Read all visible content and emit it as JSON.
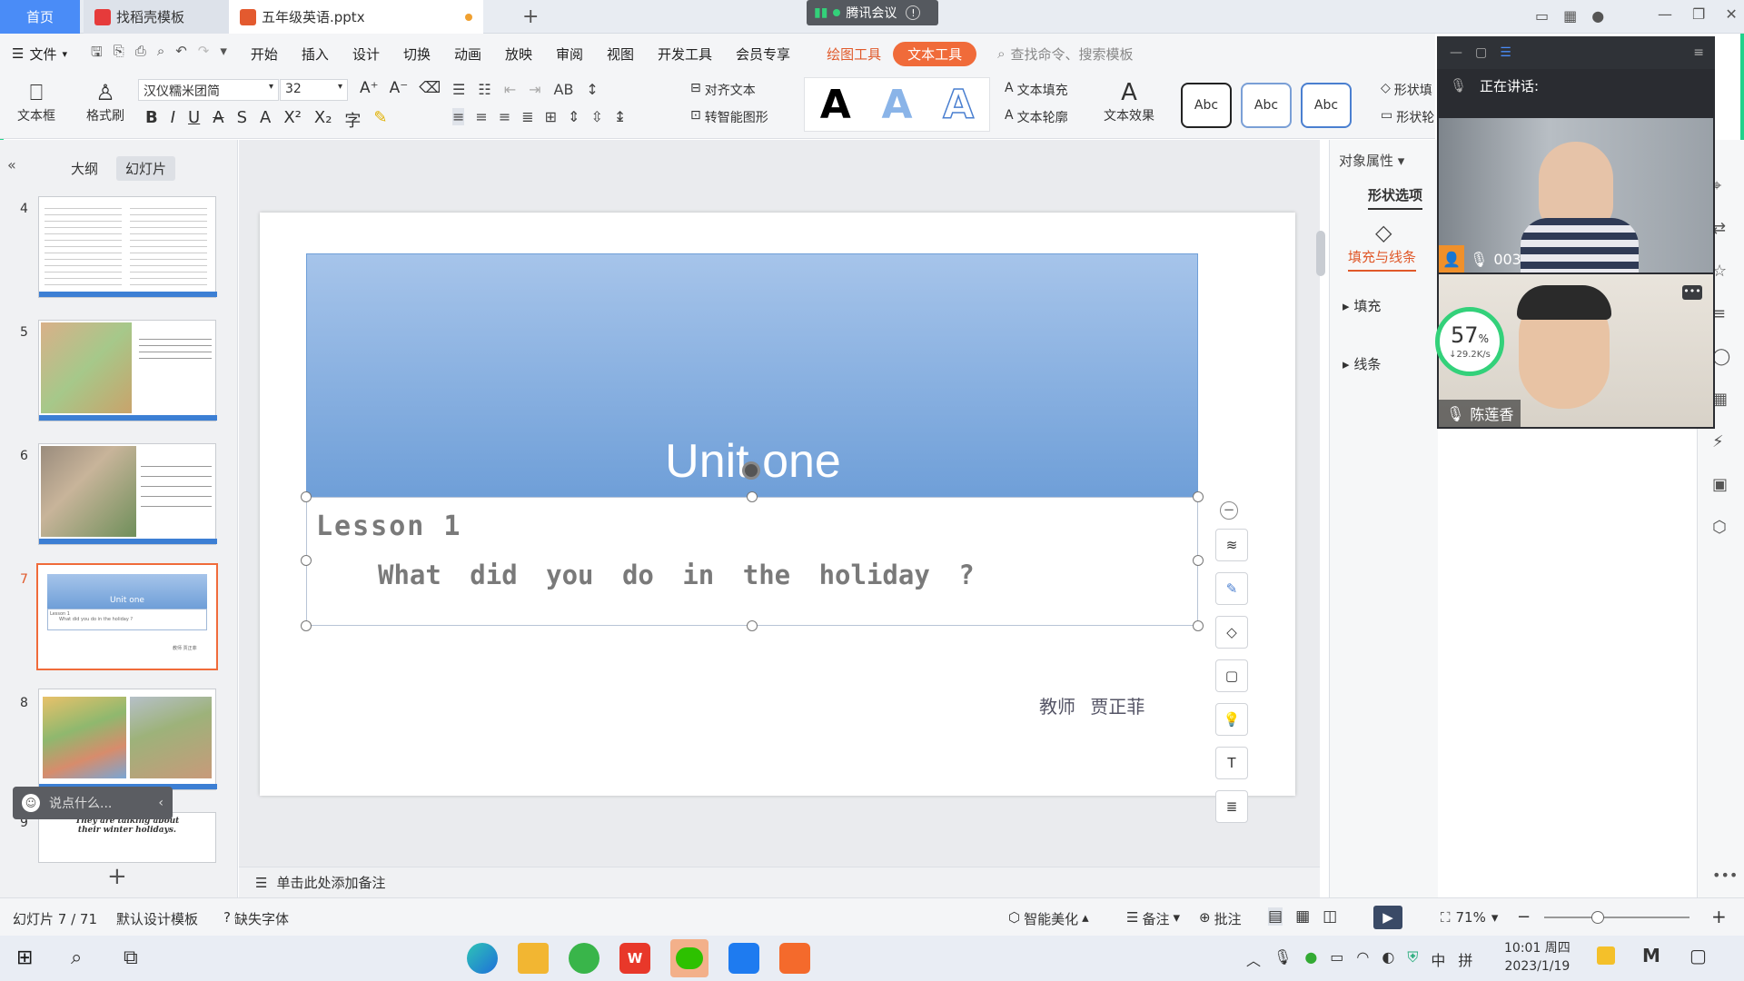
{
  "tabs": {
    "home": "首页",
    "template": "找稻壳模板",
    "file": "五年级英语.pptx",
    "meeting": "腾讯会议"
  },
  "menu": {
    "file": "文件",
    "items": [
      "开始",
      "插入",
      "设计",
      "切换",
      "动画",
      "放映",
      "审阅",
      "视图",
      "开发工具",
      "会员专享"
    ],
    "draw_tools": "绘图工具",
    "text_tools": "文本工具",
    "search_placeholder": "查找命令、搜索模板"
  },
  "toolbar": {
    "textbox": "文本框",
    "format_brush": "格式刷",
    "font_name": "汉仪糯米团简",
    "font_size": "32",
    "align_text": "对齐文本",
    "smart_shape": "转智能图形",
    "text_fill": "文本填充",
    "text_outline": "文本轮廓",
    "text_effect": "文本效果",
    "abc": "Abc",
    "shape_fill": "形状填",
    "shape_outline": "形状轮",
    "big_a": "A"
  },
  "left_panel": {
    "tab_outline": "大纲",
    "tab_slides": "幻灯片",
    "slide_numbers": [
      "4",
      "5",
      "6",
      "7",
      "8",
      "9"
    ],
    "chat_placeholder": "说点什么...",
    "thumb7_title": "Unit one",
    "thumb7_lesson": "Lesson 1",
    "thumb7_q": "What did you do in the holiday ?",
    "thumb7_teacher": "教师 贾正菲",
    "thumb9_text1": "They are talking about",
    "thumb9_text2": "their winter holidays."
  },
  "slide": {
    "title": "Unit one",
    "lesson": "Lesson 1",
    "question": "What did you do in the holiday ?",
    "teacher": "教师 贾正菲"
  },
  "notes_placeholder": "单击此处添加备注",
  "right_panel": {
    "object_props": "对象属性",
    "shape_options": "形状选项",
    "fill_line": "填充与线条",
    "fill": "填充",
    "line": "线条"
  },
  "meeting": {
    "speaking": "正在讲话:",
    "user1": "003",
    "user2": "陈莲香",
    "net_percent": "57",
    "net_unit": "%",
    "net_speed": "29.2K/s"
  },
  "status": {
    "slide_pos": "幻灯片 7 / 71",
    "template": "默认设计模板",
    "missing_font": "缺失字体",
    "beautify": "智能美化",
    "notes": "备注",
    "comment": "批注",
    "zoom": "71%"
  },
  "taskbar": {
    "time": "10:01 周四",
    "date": "2023/1/19",
    "ime1": "中",
    "ime2": "拼"
  },
  "colors": {
    "accent": "#f06b3a",
    "blue": "#4a8cf7",
    "slide_band_top": "#a6c4ea",
    "slide_band_bottom": "#6f9fd8"
  }
}
